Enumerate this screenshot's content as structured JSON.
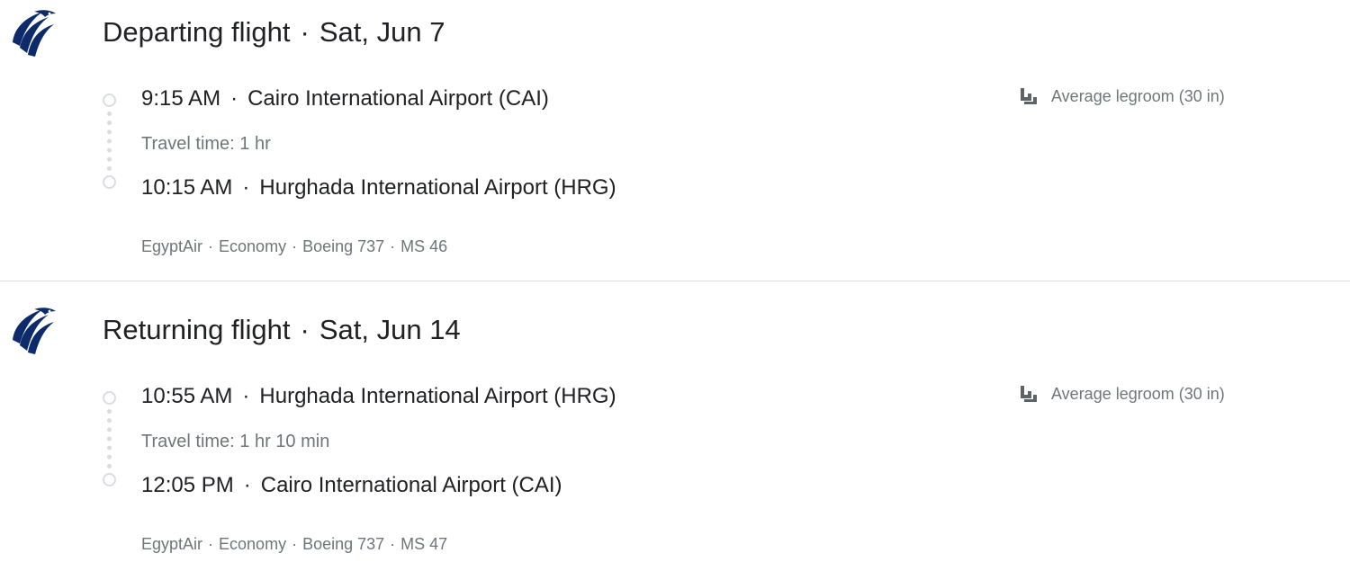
{
  "flights": [
    {
      "direction_label": "Departing flight",
      "date": "Sat, Jun 7",
      "departure": {
        "time": "9:15 AM",
        "airport": "Cairo International Airport (CAI)"
      },
      "travel_time": "Travel time: 1 hr",
      "arrival": {
        "time": "10:15 AM",
        "airport": "Hurghada International Airport (HRG)"
      },
      "legroom": "Average legroom (30 in)",
      "airline": "EgyptAir",
      "cabin": "Economy",
      "aircraft": "Boeing 737",
      "flight_number": "MS 46"
    },
    {
      "direction_label": "Returning flight",
      "date": "Sat, Jun 14",
      "departure": {
        "time": "10:55 AM",
        "airport": "Hurghada International Airport (HRG)"
      },
      "travel_time": "Travel time: 1 hr 10 min",
      "arrival": {
        "time": "12:05 PM",
        "airport": "Cairo International Airport (CAI)"
      },
      "legroom": "Average legroom (30 in)",
      "airline": "EgyptAir",
      "cabin": "Economy",
      "aircraft": "Boeing 737",
      "flight_number": "MS 47"
    }
  ],
  "separator": "·",
  "icons": {
    "airline_logo": "egyptair-logo-icon",
    "legroom": "seat-legroom-icon",
    "timeline_stop": "timeline-circle-icon"
  },
  "colors": {
    "logo_blue": "#0d2a6b",
    "primary_text": "#202124",
    "secondary_text": "#70757a",
    "timeline_gray": "#dadce0"
  }
}
